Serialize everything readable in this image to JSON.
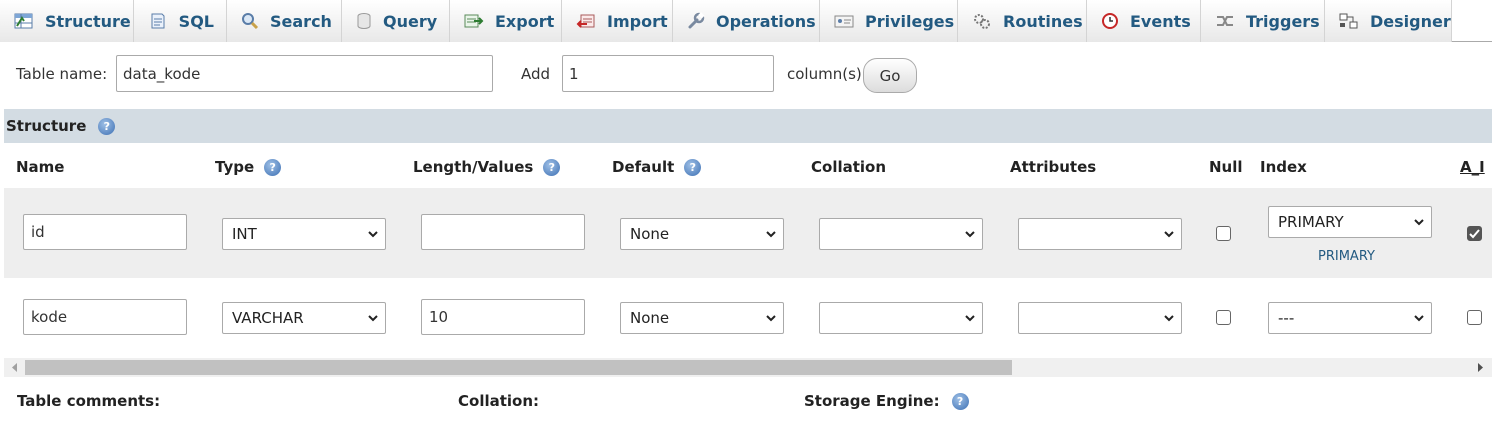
{
  "tabs": [
    {
      "label": "Structure",
      "icon": "structure-icon"
    },
    {
      "label": "SQL",
      "icon": "sql-icon"
    },
    {
      "label": "Search",
      "icon": "search-icon"
    },
    {
      "label": "Query",
      "icon": "query-icon"
    },
    {
      "label": "Export",
      "icon": "export-icon"
    },
    {
      "label": "Import",
      "icon": "import-icon"
    },
    {
      "label": "Operations",
      "icon": "wrench-icon"
    },
    {
      "label": "Privileges",
      "icon": "privileges-icon"
    },
    {
      "label": "Routines",
      "icon": "routines-icon"
    },
    {
      "label": "Events",
      "icon": "clock-icon"
    },
    {
      "label": "Triggers",
      "icon": "triggers-icon"
    },
    {
      "label": "Designer",
      "icon": "designer-icon"
    }
  ],
  "table_name_row": {
    "label": "Table name:",
    "value": "data_kode",
    "add_label": "Add",
    "add_value": "1",
    "columns_label": "column(s)",
    "go_label": "Go"
  },
  "structure": {
    "title": "Structure",
    "help_icon": "help-icon"
  },
  "columns": {
    "name": "Name",
    "type": "Type",
    "length": "Length/Values",
    "default": "Default",
    "collation": "Collation",
    "attributes": "Attributes",
    "null": "Null",
    "index": "Index",
    "ai": "A_I"
  },
  "rows": [
    {
      "name": "id",
      "type": "INT",
      "length": "",
      "default": "None",
      "collation": "",
      "attributes": "",
      "null_checked": false,
      "index": "PRIMARY",
      "index_link": "PRIMARY",
      "ai_checked": true
    },
    {
      "name": "kode",
      "type": "VARCHAR",
      "length": "10",
      "default": "None",
      "collation": "",
      "attributes": "",
      "null_checked": false,
      "index": "---",
      "ai_checked": false
    }
  ],
  "footer": {
    "table_comments": "Table comments:",
    "collation": "Collation:",
    "storage_engine": "Storage Engine:"
  },
  "colors": {
    "tab_text": "#235a81",
    "structure_header_bg": "#d3dce3",
    "row_alt_bg": "#eeeeee"
  }
}
